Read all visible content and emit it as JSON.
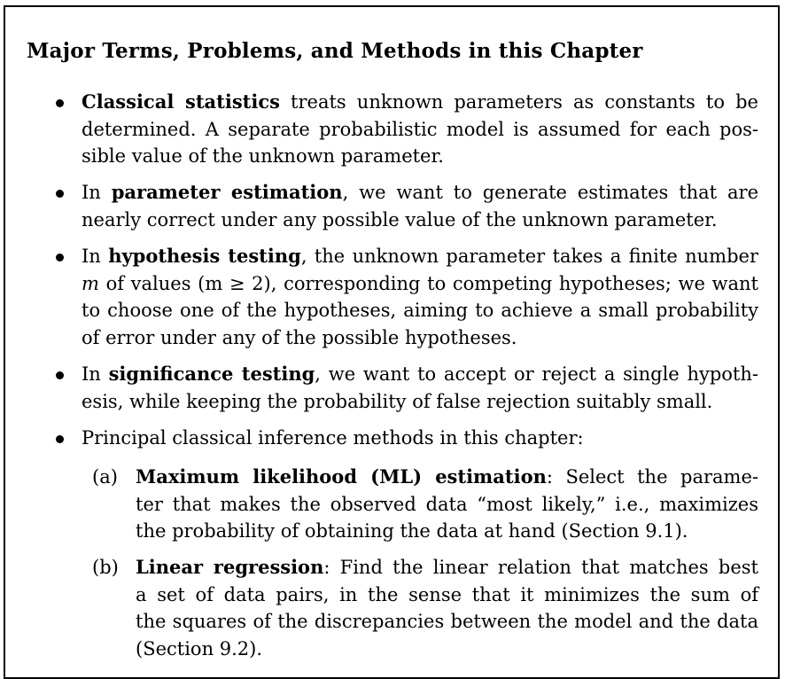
{
  "title": "Major Terms, Problems, and Methods in this Chapter",
  "bullets": [
    {
      "lines": [
        {
          "bold": "Classical statistics",
          "text": " treats unknown parameters as constants to be"
        },
        {
          "text": "determined. A separate probabilistic model is assumed for each pos-"
        },
        {
          "text": "sible value of the unknown parameter."
        }
      ]
    },
    {
      "lines": [
        {
          "pre": "In ",
          "bold": "parameter estimation",
          "text": ", we want to generate estimates that are"
        },
        {
          "text": "nearly correct under any possible value of the unknown parameter."
        }
      ]
    },
    {
      "lines": [
        {
          "pre": "In ",
          "bold": "hypothesis testing",
          "text": ", the unknown parameter takes a finite number"
        },
        {
          "italic": "m",
          "text": " of values (m ≥ 2), corresponding to competing hypotheses; we want"
        },
        {
          "text": "to choose one of the hypotheses, aiming to achieve a small probability"
        },
        {
          "text": "of error under any of the possible hypotheses."
        }
      ]
    },
    {
      "lines": [
        {
          "pre": "In ",
          "bold": "significance testing",
          "text": ", we want to accept or reject a single hypoth-"
        },
        {
          "text": "esis, while keeping the probability of false rejection suitably small."
        }
      ]
    },
    {
      "lines": [
        {
          "text": "Principal classical inference methods in this chapter:"
        }
      ]
    }
  ],
  "subitems": [
    {
      "marker": "(a)",
      "lines": [
        {
          "bold": "Maximum likelihood (ML) estimation",
          "text": ": Select the parame-"
        },
        {
          "text": "ter that makes the observed data “most likely,” i.e., maximizes"
        },
        {
          "text": "the probability of obtaining the data at hand (Section 9.1)."
        }
      ]
    },
    {
      "marker": "(b)",
      "lines": [
        {
          "bold": "Linear regression",
          "text": ": Find the linear relation that matches best"
        },
        {
          "text": "a set of data pairs, in the sense that it minimizes the sum of"
        },
        {
          "text": "the squares of the discrepancies between the model and the data"
        },
        {
          "text": "(Section 9.2)."
        }
      ]
    }
  ]
}
